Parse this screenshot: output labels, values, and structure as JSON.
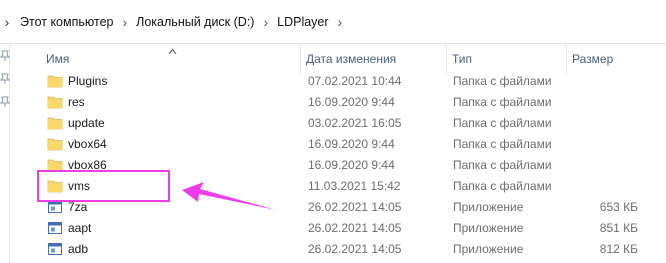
{
  "breadcrumb": {
    "items": [
      "Этот компьютер",
      "Локальный диск (D:)",
      "LDPlayer"
    ]
  },
  "columns": {
    "name": "Имя",
    "date": "Дата изменения",
    "type": "Тип",
    "size": "Размер"
  },
  "rows": [
    {
      "name": "Plugins",
      "date": "07.02.2021 10:44",
      "type": "Папка с файлами",
      "size": "",
      "kind": "folder"
    },
    {
      "name": "res",
      "date": "16.09.2020 9:44",
      "type": "Папка с файлами",
      "size": "",
      "kind": "folder"
    },
    {
      "name": "update",
      "date": "03.02.2021 16:05",
      "type": "Папка с файлами",
      "size": "",
      "kind": "folder"
    },
    {
      "name": "vbox64",
      "date": "16.09.2020 9:44",
      "type": "Папка с файлами",
      "size": "",
      "kind": "folder"
    },
    {
      "name": "vbox86",
      "date": "16.09.2020 9:44",
      "type": "Папка с файлами",
      "size": "",
      "kind": "folder"
    },
    {
      "name": "vms",
      "date": "11.03.2021 15:42",
      "type": "Папка с файлами",
      "size": "",
      "kind": "folder"
    },
    {
      "name": "7za",
      "date": "26.02.2021 14:05",
      "type": "Приложение",
      "size": "653 КБ",
      "kind": "app"
    },
    {
      "name": "aapt",
      "date": "26.02.2021 14:05",
      "type": "Приложение",
      "size": "851 КБ",
      "kind": "app"
    },
    {
      "name": "adb",
      "date": "26.02.2021 14:05",
      "type": "Приложение",
      "size": "812 КБ",
      "kind": "app"
    }
  ],
  "colors": {
    "highlight": "#ee3de6",
    "folder": "#f8d775",
    "header_text": "#4c607a"
  },
  "annotation": {
    "highlighted_item": "vms"
  }
}
